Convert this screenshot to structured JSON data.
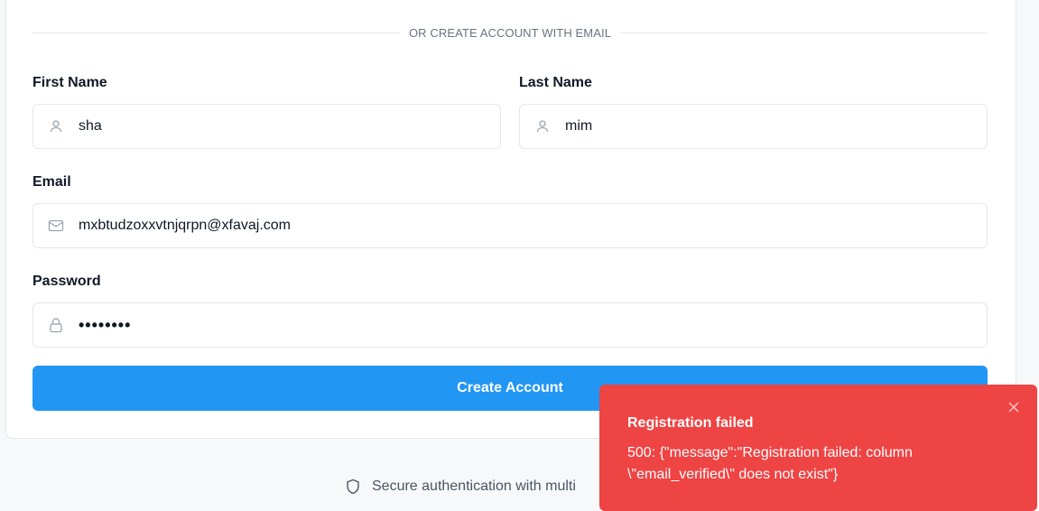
{
  "divider_text": "OR CREATE ACCOUNT WITH EMAIL",
  "form": {
    "first_name": {
      "label": "First Name",
      "value": "sha"
    },
    "last_name": {
      "label": "Last Name",
      "value": "mim"
    },
    "email": {
      "label": "Email",
      "value": "mxbtudzoxxvtnjqrpn@xfavaj.com"
    },
    "password": {
      "label": "Password",
      "value": "••••••••"
    },
    "submit_label": "Create Account"
  },
  "footer_text": "Secure authentication with multi",
  "toast": {
    "title": "Registration failed",
    "message": "500: {\"message\":\"Registration failed: column \\\"email_verified\\\" does not exist\"}"
  },
  "colors": {
    "primary": "#2196f3",
    "error": "#ef4444"
  },
  "icons": {
    "first_name": "user-icon",
    "last_name": "user-icon",
    "email": "mail-icon",
    "password": "lock-icon",
    "footer": "shield-icon",
    "toast_close": "close-icon"
  }
}
